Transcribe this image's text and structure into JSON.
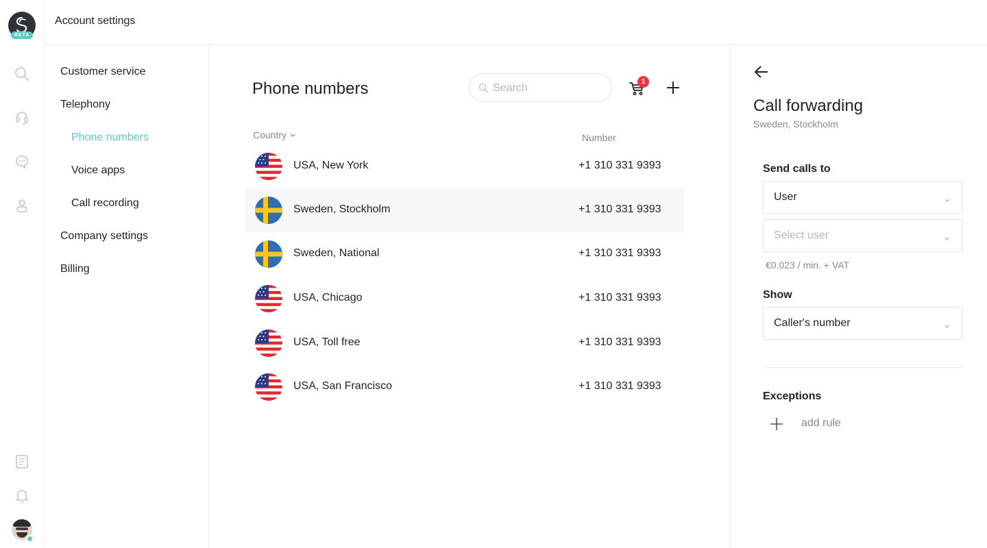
{
  "rail": {
    "logo_badge": "BETA",
    "icons": [
      "search-icon",
      "headset-icon",
      "chat-icon",
      "contacts-icon",
      "report-icon",
      "bell-icon"
    ],
    "accent_color": "#59c9c4"
  },
  "topbar": {
    "title": "Account settings"
  },
  "nav": {
    "items": [
      {
        "label": "Customer service",
        "level": 1
      },
      {
        "label": "Telephony",
        "level": 1
      },
      {
        "label": "Phone numbers",
        "level": 2,
        "active": true
      },
      {
        "label": "Voice apps",
        "level": 2
      },
      {
        "label": "Call recording",
        "level": 2
      },
      {
        "label": "Company settings",
        "level": 1
      },
      {
        "label": "Billing",
        "level": 1
      }
    ]
  },
  "main": {
    "title": "Phone numbers",
    "search_placeholder": "Search",
    "cart_count": "1",
    "columns": {
      "country": "Country",
      "number": "Number"
    },
    "rows": [
      {
        "flag": "usa",
        "name": "USA, New York",
        "number": "+1 310 331 9393"
      },
      {
        "flag": "sweden",
        "name": "Sweden, Stockholm",
        "number": "+1 310 331 9393",
        "selected": true
      },
      {
        "flag": "sweden",
        "name": "Sweden, National",
        "number": "+1 310 331 9393"
      },
      {
        "flag": "usa",
        "name": "USA, Chicago",
        "number": "+1 310 331 9393"
      },
      {
        "flag": "usa",
        "name": "USA, Toll free",
        "number": "+1 310 331 9393"
      },
      {
        "flag": "usa",
        "name": "USA, San Francisco",
        "number": "+1 310 331 9393"
      }
    ]
  },
  "panel": {
    "title": "Call forwarding",
    "subtitle": "Sweden, Stockholm",
    "send_calls_label": "Send calls to",
    "send_calls_value": "User",
    "select_user_placeholder": "Select user",
    "price": "€0.023 / min. + VAT",
    "show_label": "Show",
    "show_value": "Caller's number",
    "exceptions_label": "Exceptions",
    "add_rule": "add rule"
  }
}
